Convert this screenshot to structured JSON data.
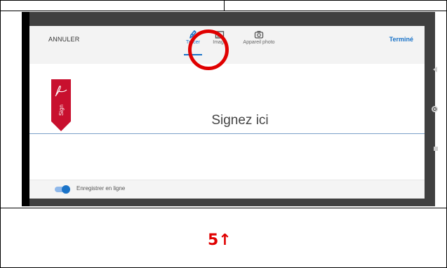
{
  "toolbar": {
    "cancel_label": "ANNULER",
    "done_label": "Terminé",
    "tabs": [
      {
        "label": "Tracer",
        "icon": "pen-icon",
        "active": true
      },
      {
        "label": "Image",
        "icon": "image-icon",
        "active": false
      },
      {
        "label": "Appareil photo",
        "icon": "camera-icon",
        "active": false
      }
    ]
  },
  "signature": {
    "placeholder": "Signez ici",
    "flag_text": "Sign"
  },
  "footer": {
    "save_online_label": "Enregistrer en ligne",
    "save_online_enabled": true
  },
  "annotation": {
    "step_label": "5↑"
  },
  "colors": {
    "accent": "#1a73c8",
    "highlight": "#e00000",
    "flag": "#c8102e"
  }
}
